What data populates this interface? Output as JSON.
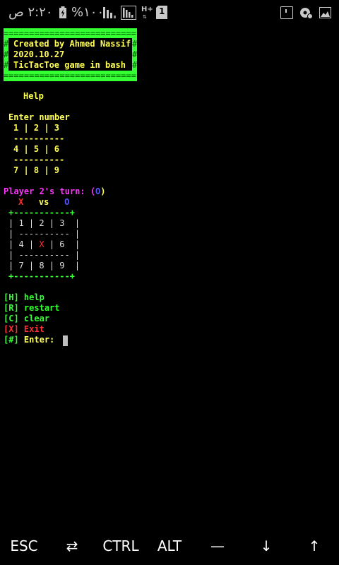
{
  "status_bar": {
    "time": "٢:٢٠ ص",
    "battery_percent": "%١٠٠",
    "network_type": "H+",
    "sim_slot": "1"
  },
  "banner": {
    "lines": [
      "Created by Ahmed Nassif",
      "2020.10.27",
      "TicTacToe game in bash"
    ]
  },
  "terminal": {
    "help_title": "Help",
    "enter_number": "Enter number",
    "help_rows": [
      "1 | 2 | 3",
      "----------",
      "4 | 5 | 6",
      "----------",
      "7 | 8 | 9"
    ],
    "turn_label": "Player 2's turn: (",
    "turn_symbol": "O",
    "turn_close": ")",
    "player_x": "X",
    "vs": "vs",
    "player_o": "O",
    "board_border": "+-----------+",
    "board_rows": [
      {
        "pre": "| 1 | 2 | 3  |"
      },
      {
        "pre": "| ---------- |"
      },
      {
        "a": "| 4 | ",
        "mark": "X",
        "b": " | 6  |"
      },
      {
        "pre": "| ---------- |"
      },
      {
        "pre": "| 7 | 8 | 9  |"
      }
    ],
    "menu": [
      {
        "key": "[H]",
        "label": "help"
      },
      {
        "key": "[R]",
        "label": "restart"
      },
      {
        "key": "[C]",
        "label": "clear"
      },
      {
        "key": "[X]",
        "label": "Exit"
      },
      {
        "key": "[#]",
        "label": "Enter:"
      }
    ]
  },
  "extra_keys": [
    "ESC",
    "⇄",
    "CTRL",
    "ALT",
    "—",
    "↓",
    "↑"
  ],
  "colors": {
    "green": "#33ff33",
    "yellow": "#ffff55",
    "red": "#ff3030",
    "magenta": "#ff33ff",
    "blue": "#5555ff"
  }
}
